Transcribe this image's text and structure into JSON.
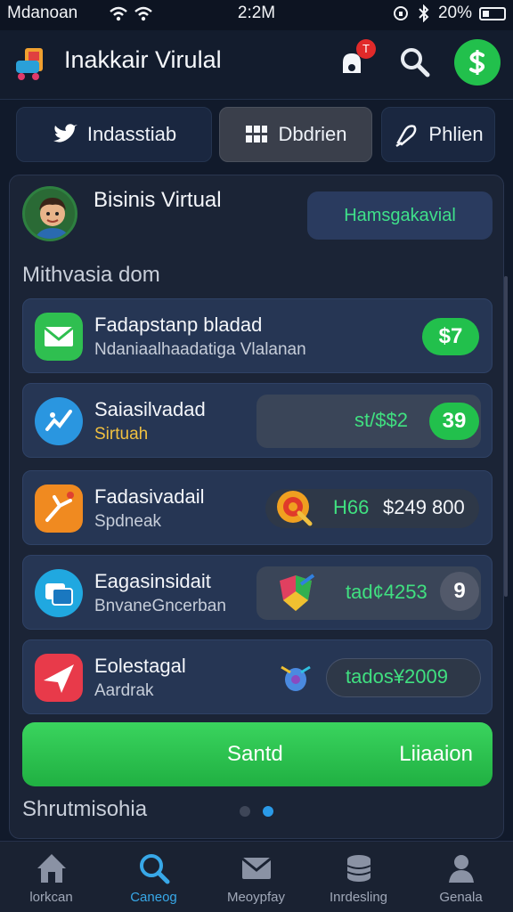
{
  "status_bar": {
    "carrier": "Mdanoan",
    "time": "2:2M",
    "battery": "20%"
  },
  "app_bar": {
    "title": "Inakkair Virulal",
    "notification_count": "T"
  },
  "tabs": [
    {
      "label": "Indasstiab",
      "icon": "twitter-icon"
    },
    {
      "label": "Dbdrien",
      "icon": "grid-icon",
      "active": true
    },
    {
      "label": "Phlien",
      "icon": "phone-pen-icon"
    }
  ],
  "profile": {
    "name": "Bisinis Virtual",
    "action_label": "Hamsgakavial"
  },
  "section_title": "Mithvasia dom",
  "items": [
    {
      "title": "Fadapstanp bladad",
      "subtitle": "Ndaniaalhaadatiga Vlalanan",
      "price": "$7",
      "icon": "mail-app-icon"
    },
    {
      "title": "Saiasilvadad",
      "subtitle": "Sirtuah",
      "price_text": "st/$$2",
      "price_pill": "39",
      "icon": "chart-app-icon"
    },
    {
      "title": "Fadasivadail",
      "subtitle": "Spdneak",
      "price_label": "H66",
      "price_value": "$249 800",
      "icon": "tools-app-icon"
    },
    {
      "title": "Eagasinsidait",
      "subtitle": "BnvaneGncerban",
      "price_text": "tad¢4253",
      "badge": "9",
      "icon": "gallery-app-icon"
    },
    {
      "title": "Eolestagal",
      "subtitle": "Aardrak",
      "price_text": "tados¥2009",
      "icon": "plane-app-icon"
    }
  ],
  "cta": {
    "left_label": "Santd",
    "right_label": "Liiaaion"
  },
  "footer_title": "Shrutmisohia",
  "pager": {
    "pages": 2,
    "active": 2
  },
  "bottom_nav": [
    {
      "label": "lorkcan",
      "icon": "home-icon"
    },
    {
      "label": "Caneog",
      "icon": "search-icon",
      "active": true
    },
    {
      "label": "Meoypfay",
      "icon": "mail-icon"
    },
    {
      "label": "Inrdesling",
      "icon": "coins-icon"
    },
    {
      "label": "Genala",
      "icon": "profile-icon"
    }
  ],
  "colors": {
    "accent_green": "#22c04c",
    "price_green": "#40e080",
    "active_blue": "#38a8e8",
    "background": "#111a2b"
  }
}
